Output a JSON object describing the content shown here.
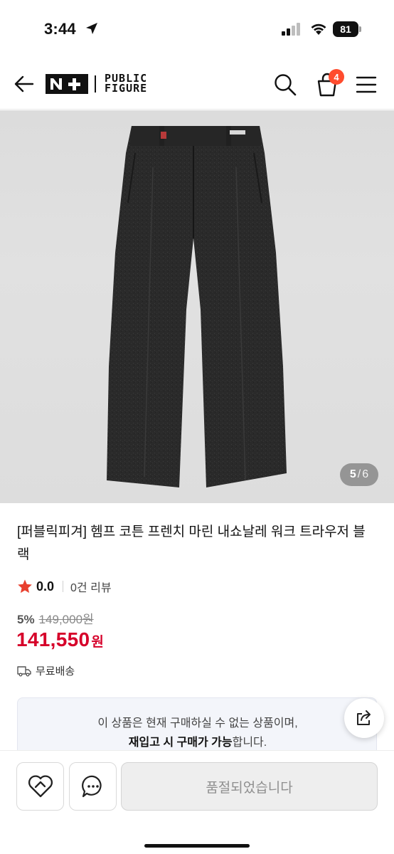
{
  "status_bar": {
    "time": "3:44",
    "battery": "81"
  },
  "header": {
    "logo_mark": "N+",
    "brand_line1": "PUBLIC",
    "brand_line2": "FIGURE",
    "cart_count": "4",
    "icons": [
      "back-arrow-icon",
      "search-icon",
      "cart-icon",
      "menu-icon"
    ]
  },
  "gallery": {
    "current": "5",
    "separator": "/",
    "total": "6"
  },
  "product": {
    "title": "[퍼블릭피겨] 헴프 코튼 프렌치 마린 내쇼날레 워크 트라우저 블랙",
    "rating": "0.0",
    "review_count": "0건 리뷰",
    "discount": "5%",
    "original_price": "149,000원",
    "price": "141,550",
    "price_unit": "원",
    "shipping": "무료배송"
  },
  "notice": {
    "line1": "이 상품은 현재 구매하실 수 없는 상품이며,",
    "line2_bold": "재입고 시 구매가 가능",
    "line2_rest": "합니다."
  },
  "bottom_bar": {
    "soldout_label": "품절되었습니다"
  },
  "colors": {
    "price": "#d6002a",
    "star": "#e8402e",
    "badge": "#ff4c2e",
    "notice_bg": "#f3f5fa"
  }
}
